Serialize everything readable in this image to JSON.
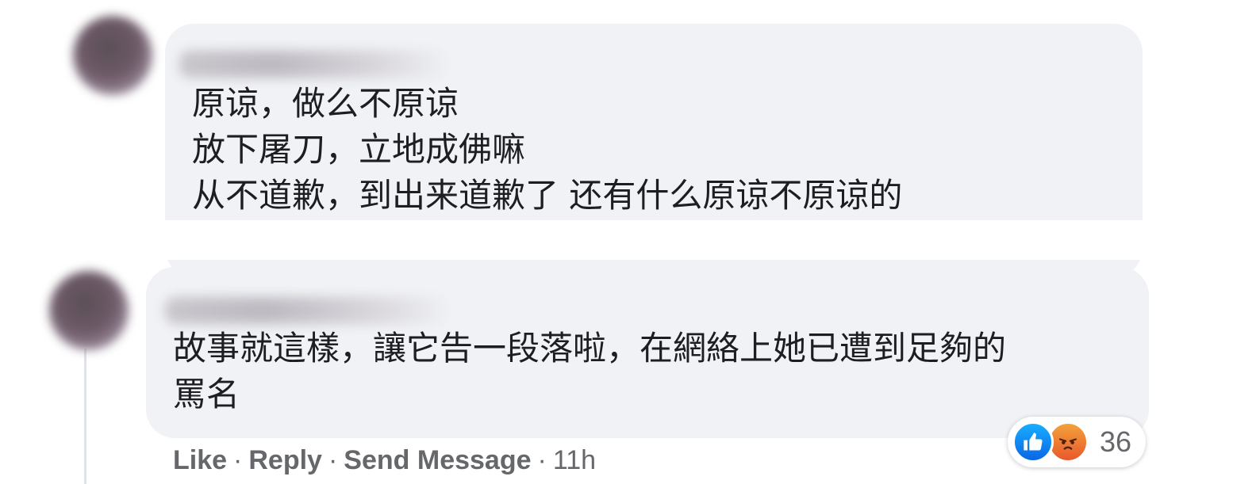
{
  "comments": [
    {
      "lines": [
        "原谅，做么不原谅",
        "放下屠刀，立地成佛嘛",
        "从不道歉，到出来道歉了 还有什么原谅不原谅的"
      ]
    },
    {
      "lines": [
        "故事就這樣，讓它告一段落啦，在網絡上她已遭到足夠的",
        "罵名"
      ],
      "reactions": {
        "icons": [
          "like-icon",
          "angry-icon"
        ],
        "count": "36"
      },
      "actions": {
        "like": "Like",
        "reply": "Reply",
        "send_message": "Send Message",
        "separator": "·",
        "time": "11h"
      }
    }
  ],
  "colors": {
    "bubble": "#f0f2f5",
    "text": "#1c1e21",
    "meta": "#65676b",
    "like_blue": "#0a66e6",
    "angry_orange": "#e8582c"
  }
}
